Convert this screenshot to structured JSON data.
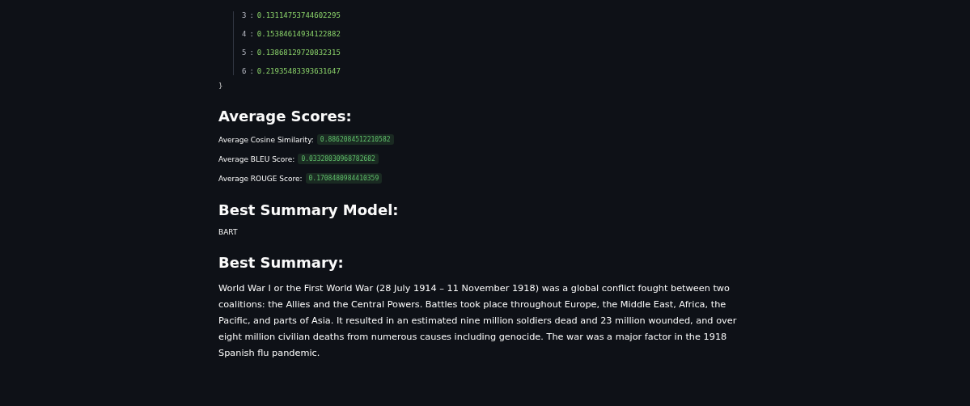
{
  "json_view": {
    "entries": [
      {
        "key": "3",
        "separator": ":",
        "value": "0.13114753744602295"
      },
      {
        "key": "4",
        "separator": ":",
        "value": "0.15384614934122882"
      },
      {
        "key": "5",
        "separator": ":",
        "value": "0.13868129720832315"
      },
      {
        "key": "6",
        "separator": ":",
        "value": "0.21935483393631647"
      }
    ],
    "closing": "}"
  },
  "average_scores": {
    "heading": "Average Scores:",
    "items": [
      {
        "label": "Average Cosine Similarity:",
        "value": "0.8862084512210582"
      },
      {
        "label": "Average BLEU Score:",
        "value": "0.03328030968782682"
      },
      {
        "label": "Average ROUGE Score:",
        "value": "0.1708480984410359"
      }
    ]
  },
  "best_model": {
    "heading": "Best Summary Model:",
    "value": "BART"
  },
  "best_summary": {
    "heading": "Best Summary:",
    "text": "World War I or the First World War (28 July 1914 – 11 November 1918) was a global conflict fought between two coalitions: the Allies and the Central Powers. Battles took place throughout Europe, the Middle East, Africa, the Pacific, and parts of Asia. It resulted in an estimated nine million soldiers dead and 23 million wounded, and over eight million civilian deaths from numerous causes including genocide. The war was a major factor in the 1918 Spanish flu pandemic."
  }
}
